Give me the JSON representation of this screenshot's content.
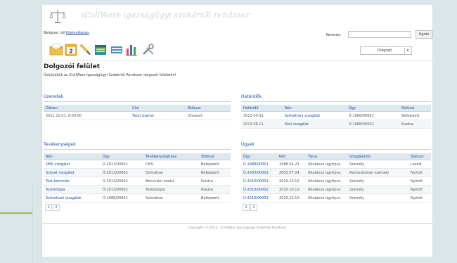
{
  "app": {
    "title": "iCollWare igazságügyi szakértői rendszer"
  },
  "login": {
    "label": "Belépve:",
    "user": "Izil",
    "logout": "Kijelentkezés"
  },
  "search": {
    "label": "Keresés:",
    "button": "Ugrás"
  },
  "select": {
    "value": "Dolgozó"
  },
  "toolbar": {
    "icons": [
      "envelope-icon",
      "calendar-icon",
      "brush-icon",
      "folder-icon",
      "document-stack-icon",
      "bar-chart-icon",
      "tools-icon"
    ],
    "calendar_number": "2"
  },
  "page": {
    "title": "Dolgozói felület",
    "welcome": "Üdvözöljük az iCollWare Igazságügyi Szakértői Rendszer dolgozói felületén!"
  },
  "messages": {
    "title": "Üzenetek",
    "headers": [
      "Dátum",
      "Cím",
      "Státusz"
    ],
    "rows": [
      [
        "2012.12.01. 0:00:00",
        "Teszt üzenet",
        "Olvasott"
      ]
    ]
  },
  "deadlines": {
    "title": "Határidők",
    "headers": [
      "Határidő",
      "Név",
      "Ügy",
      "Státusz"
    ],
    "rows": [
      [
        "2013.04.02.",
        "Szövettani vizsgálat",
        "Ü-1988/00001",
        "Befejezett"
      ],
      [
        "2013.06.11.",
        "Kezi vizsgálat",
        "Ü-1988/00001",
        "Kiadva"
      ]
    ]
  },
  "activities": {
    "title": "Tevékenységek",
    "headers": [
      "Név",
      "Ügy",
      "Tevékenységtípus",
      "Státusz"
    ],
    "rows": [
      [
        "DNS vizsgálat",
        "Ü-2013/00002",
        "DNS",
        "Befejezett"
      ],
      [
        "Szövet vizsgálat",
        "Ü-2013/00002",
        "Szövettan",
        "Befejezett"
      ],
      [
        "Test boncolás",
        "Ü-2013/00002",
        "Boncolási modul",
        "Kiadva"
      ],
      [
        "Toxikológia",
        "Ü-2013/00002",
        "Toxikológia",
        "Kiadva"
      ],
      [
        "Szövettani vizsgálat",
        "Ü-1988/00001",
        "Szövettan",
        "Befejezett"
      ]
    ],
    "pages": [
      "1",
      "2"
    ]
  },
  "cases": {
    "title": "Ügyek",
    "headers": [
      "Ügy",
      "Kelt",
      "Típus",
      "Vizsgálandó",
      "Státusz"
    ],
    "rows": [
      [
        "Ü-1988/00001",
        "1988.04.23.",
        "Általános ügytípus",
        "Személy",
        "Lezárt"
      ],
      [
        "Ü-2003/00001",
        "2003.07.04.",
        "Általános ügytípus",
        "Azonosítatlan személy",
        "Nyitott"
      ],
      [
        "Ü-2010/00001",
        "2010.10.10.",
        "Általános ügytípus",
        "Személy",
        "Nyitott"
      ],
      [
        "Ü-2010/00002",
        "2010.10.10.",
        "Általános ügytípus",
        "Személy",
        "Nyitott"
      ],
      [
        "Ü-2010/00003",
        "2010.10.10.",
        "Általános ügytípus",
        "Személy",
        "Nyitott"
      ]
    ],
    "pages": [
      "1",
      "2"
    ]
  },
  "footer": {
    "text": "Copyright (c) 2012 - iCollWare Igazságügyi Szakértői Rendszer"
  }
}
